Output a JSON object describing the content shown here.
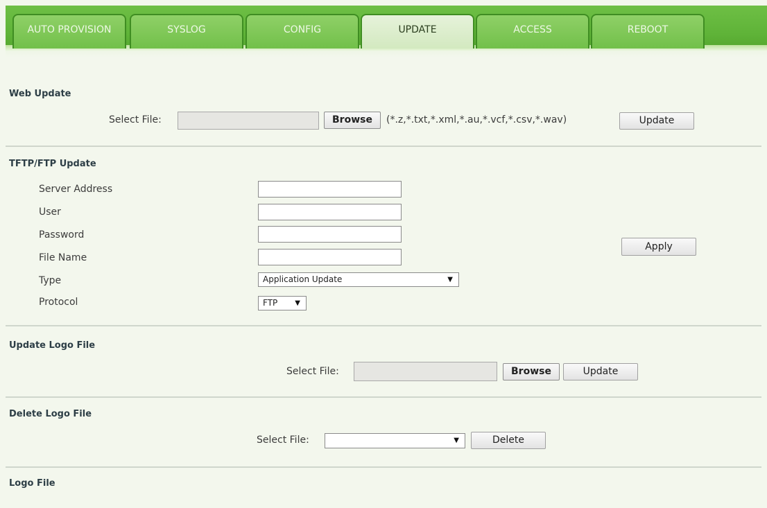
{
  "tabs": [
    {
      "label": "AUTO PROVISION",
      "active": false
    },
    {
      "label": "SYSLOG",
      "active": false
    },
    {
      "label": "CONFIG",
      "active": false
    },
    {
      "label": "UPDATE",
      "active": true
    },
    {
      "label": "ACCESS",
      "active": false
    },
    {
      "label": "REBOOT",
      "active": false
    }
  ],
  "web_update": {
    "title": "Web Update",
    "select_file_label": "Select File:",
    "file_value": "",
    "browse_label": "Browse",
    "extensions": "(*.z,*.txt,*.xml,*.au,*.vcf,*.csv,*.wav)",
    "update_label": "Update"
  },
  "tftp_update": {
    "title": "TFTP/FTP Update",
    "server_address_label": "Server Address",
    "server_address_value": "",
    "user_label": "User",
    "user_value": "",
    "password_label": "Password",
    "password_value": "",
    "file_name_label": "File Name",
    "file_name_value": "",
    "type_label": "Type",
    "type_value": "Application Update",
    "protocol_label": "Protocol",
    "protocol_value": "FTP",
    "apply_label": "Apply"
  },
  "update_logo": {
    "title": "Update Logo File",
    "select_file_label": "Select File:",
    "file_value": "",
    "browse_label": "Browse",
    "update_label": "Update"
  },
  "delete_logo": {
    "title": "Delete Logo File",
    "select_file_label": "Select File:",
    "select_value": "",
    "delete_label": "Delete"
  },
  "logo_file": {
    "title": "Logo File"
  },
  "icons": {
    "dropdown_arrow": "▼"
  },
  "colors": {
    "tab_bar": "#5fb338",
    "active_tab": "#d3e9c0",
    "page_background": "#f3f7ed",
    "section_title": "#2d3e46"
  }
}
